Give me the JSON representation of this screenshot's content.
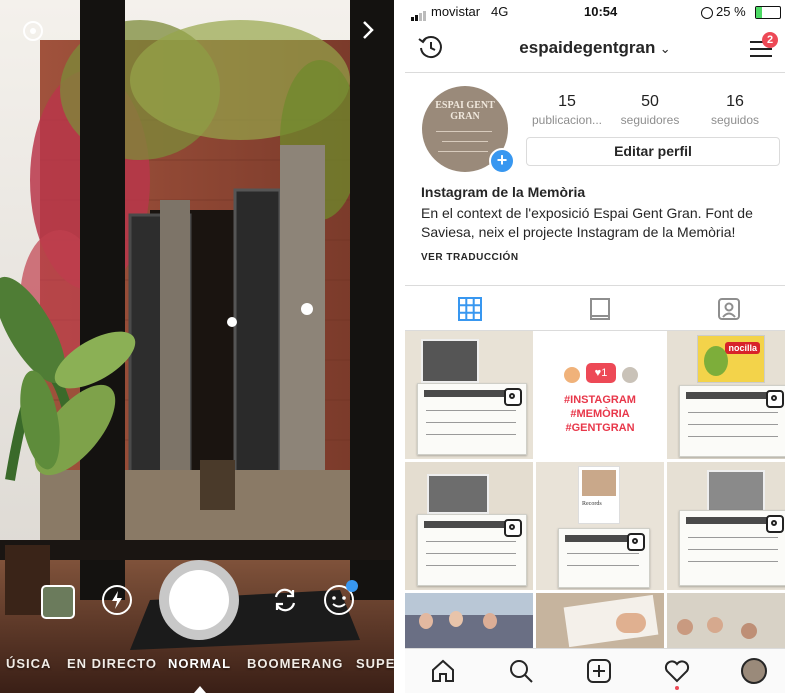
{
  "camera": {
    "modes": [
      "ÚSICA",
      "EN DIRECTO",
      "NORMAL",
      "BOOMERANG",
      "SUPE"
    ],
    "active_mode": "NORMAL",
    "icons": {
      "settings": "gear-icon",
      "next": "chevron-right-icon",
      "gallery": "gallery-thumbnail",
      "flash": "flash-icon",
      "flip": "flip-camera-icon",
      "face": "face-filter-icon"
    }
  },
  "status_bar": {
    "carrier": "movistar",
    "network": "4G",
    "time": "10:54",
    "battery": "25 %"
  },
  "header": {
    "username": "espaidegentgran",
    "notification_count": "2"
  },
  "profile": {
    "stats": [
      {
        "value": "15",
        "label": "publicacion..."
      },
      {
        "value": "50",
        "label": "seguidores"
      },
      {
        "value": "16",
        "label": "seguidos"
      }
    ],
    "edit_button": "Editar perfil",
    "name": "Instagram de la Memòria",
    "bio": "En el context de l'exposició Espai Gent Gran. Font de Saviesa, neix el projecte Instagram de la Memòria!",
    "translate_link": "VER TRADUCCIÓN",
    "avatar_text": "ESPAI GENT GRAN"
  },
  "grid": {
    "hashtag_post": {
      "like_count": "1",
      "tags": [
        "#INSTAGRAM",
        "#MEMÒRIA",
        "#GENTGRAN"
      ]
    },
    "nocilla_label": "nocilla",
    "nocilla_text": "Records"
  },
  "colors": {
    "accent_blue": "#3897f0",
    "badge_red": "#ed4956",
    "hashtag_red": "#e8374a"
  }
}
